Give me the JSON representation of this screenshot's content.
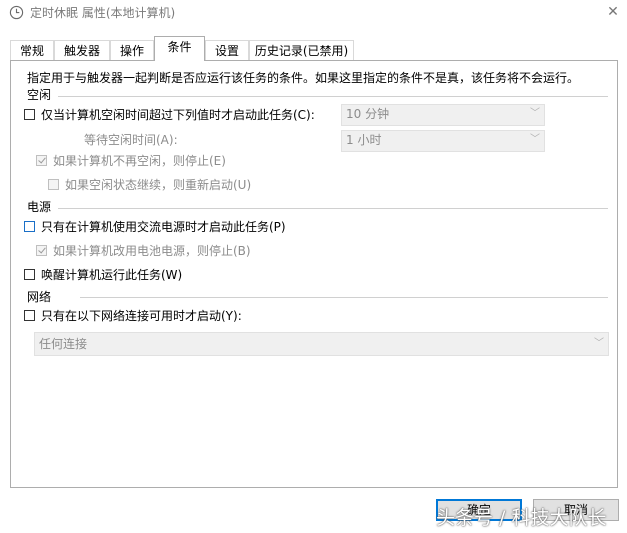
{
  "window": {
    "title": "定时休眠 属性(本地计算机)",
    "close_glyph": "✕"
  },
  "tabs": [
    {
      "label": "常规"
    },
    {
      "label": "触发器"
    },
    {
      "label": "操作"
    },
    {
      "label": "条件"
    },
    {
      "label": "设置"
    },
    {
      "label": "历史记录(已禁用)"
    }
  ],
  "active_tab": "条件",
  "conditions": {
    "intro": "指定用于与触发器一起判断是否应运行该任务的条件。如果这里指定的条件不是真，该任务将不会运行。",
    "idle": {
      "section": "空闲",
      "start_if_idle_label": "仅当计算机空闲时间超过下列值时才启动此任务(C):",
      "idle_duration_value": "10 分钟",
      "wait_label": "等待空闲时间(A):",
      "wait_value": "1 小时",
      "stop_if_not_idle_label": "如果计算机不再空闲，则停止(E)",
      "restart_if_idle_resumes_label": "如果空闲状态继续，则重新启动(U)"
    },
    "power": {
      "section": "电源",
      "ac_only_label": "只有在计算机使用交流电源时才启动此任务(P)",
      "stop_on_battery_label": "如果计算机改用电池电源，则停止(B)",
      "wake_label": "唤醒计算机运行此任务(W)"
    },
    "network": {
      "section": "网络",
      "network_only_label": "只有在以下网络连接可用时才启动(Y):",
      "connection_value": "任何连接"
    }
  },
  "buttons": {
    "ok": "确定",
    "cancel": "取消"
  },
  "watermark": "头条号 / 科技大队长",
  "colors": {
    "accent": "#0078d7",
    "disabled_text": "#8c8c8c",
    "panel_border": "#adadad"
  },
  "icons": {
    "title": "clock-icon",
    "close": "close-icon",
    "dropdown": "chevron-down-icon"
  }
}
